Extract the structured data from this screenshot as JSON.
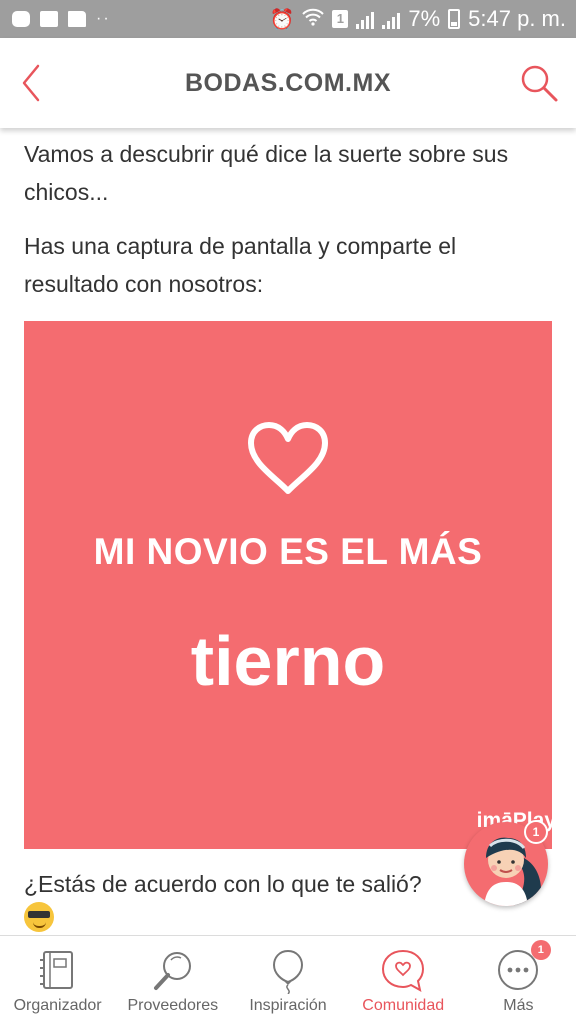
{
  "status_bar": {
    "battery": "7%",
    "sim_slot": "1",
    "time": "5:47 p. m."
  },
  "header": {
    "title": "BODAS.COM.MX"
  },
  "content": {
    "paragraph_1": "Vamos a descubrir qué dice la suerte sobre sus chicos...",
    "paragraph_2": "Has una captura de pantalla y comparte el resultado con nosotros:",
    "banner": {
      "line_1": "MI NOVIO ES EL MÁS",
      "line_2": "tierno",
      "brand": "imāPlay"
    },
    "question": "¿Estás de acuerdo con lo que te salió?"
  },
  "assistant": {
    "badge": "1"
  },
  "bottom_nav": {
    "items": [
      {
        "label": "Organizador",
        "icon": "notebook-icon"
      },
      {
        "label": "Proveedores",
        "icon": "magnifier-icon"
      },
      {
        "label": "Inspiración",
        "icon": "balloon-icon"
      },
      {
        "label": "Comunidad",
        "icon": "chat-heart-icon",
        "active": true
      },
      {
        "label": "Más",
        "icon": "more-icon",
        "badge": "1"
      }
    ]
  },
  "colors": {
    "accent": "#f46c70",
    "active_nav": "#e8555c",
    "status_bar": "#9e9e9e"
  }
}
